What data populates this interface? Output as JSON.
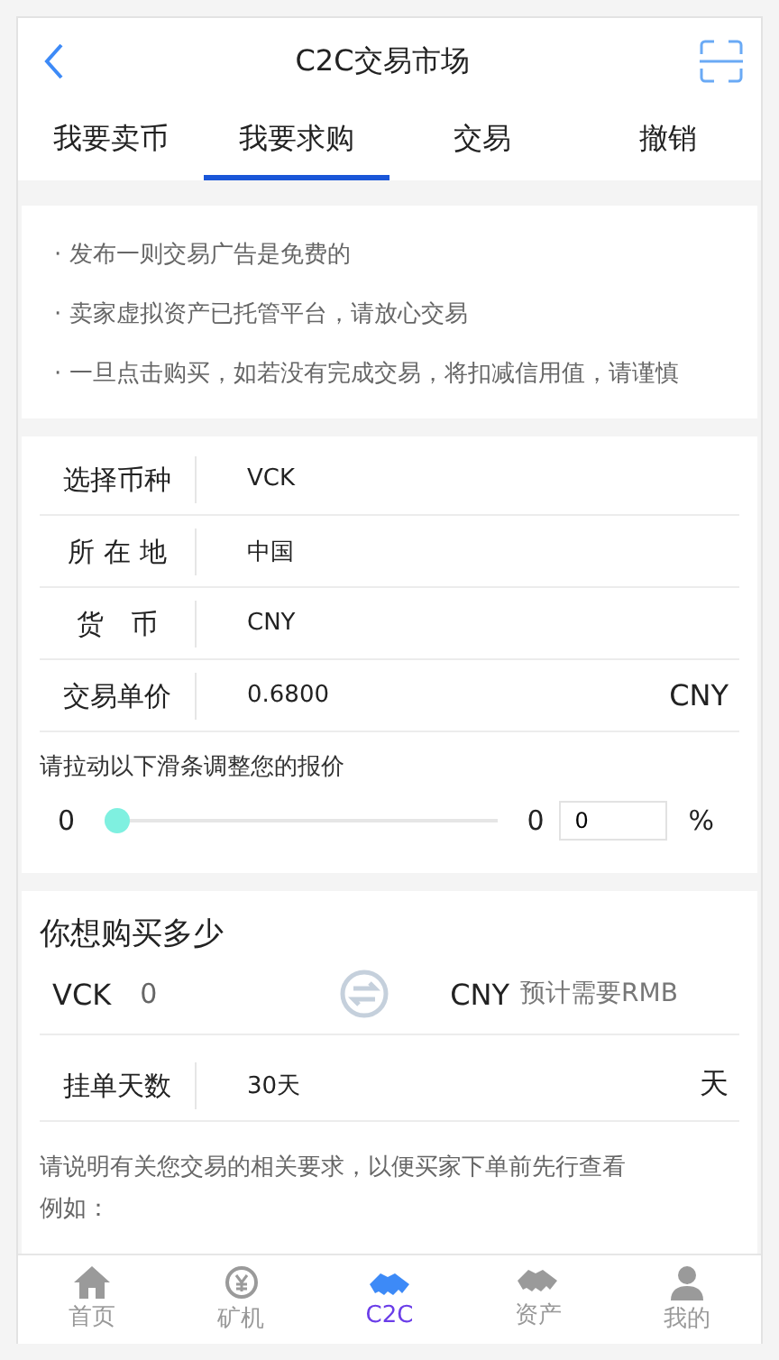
{
  "header": {
    "title": "C2C交易市场"
  },
  "tabs": [
    {
      "label": "我要卖币",
      "selected": false
    },
    {
      "label": "我要求购",
      "selected": true
    },
    {
      "label": "交易",
      "selected": false
    },
    {
      "label": "撤销",
      "selected": false
    }
  ],
  "notices": [
    "· 发布一则交易广告是免费的",
    "· 卖家虚拟资产已托管平台，请放心交易",
    "· 一旦点击购买，如若没有完成交易，将扣减信用值，请谨慎"
  ],
  "form_rows": [
    {
      "label": "选择币种",
      "value": "VCK"
    },
    {
      "label": "所 在 地",
      "value": "中国"
    },
    {
      "label": "货　币",
      "value": "CNY"
    },
    {
      "label": "交易单价",
      "value": "0.6800",
      "unit": "CNY"
    }
  ],
  "slider": {
    "hint": "请拉动以下滑条调整您的报价",
    "min": "0",
    "max": "0",
    "level": 0,
    "input_value": "0",
    "unit": "%"
  },
  "buy": {
    "title": "你想购买多少",
    "left_currency": "VCK",
    "left_value": "0",
    "right_currency": "CNY",
    "right_placeholder": "预计需要RMB"
  },
  "days": {
    "label": "挂单天数",
    "value": "30天",
    "unit": "天"
  },
  "description": [
    "请说明有关您交易的相关要求，以便买家下单前先行查看",
    "例如："
  ],
  "nav": [
    {
      "label": "首页",
      "kind": "home",
      "selected": false
    },
    {
      "label": "矿机",
      "kind": "coin",
      "selected": false
    },
    {
      "label": "C2C",
      "kind": "handshake",
      "selected": true
    },
    {
      "label": "资产",
      "kind": "handshake",
      "selected": false
    },
    {
      "label": "我的",
      "kind": "person",
      "selected": false
    }
  ]
}
